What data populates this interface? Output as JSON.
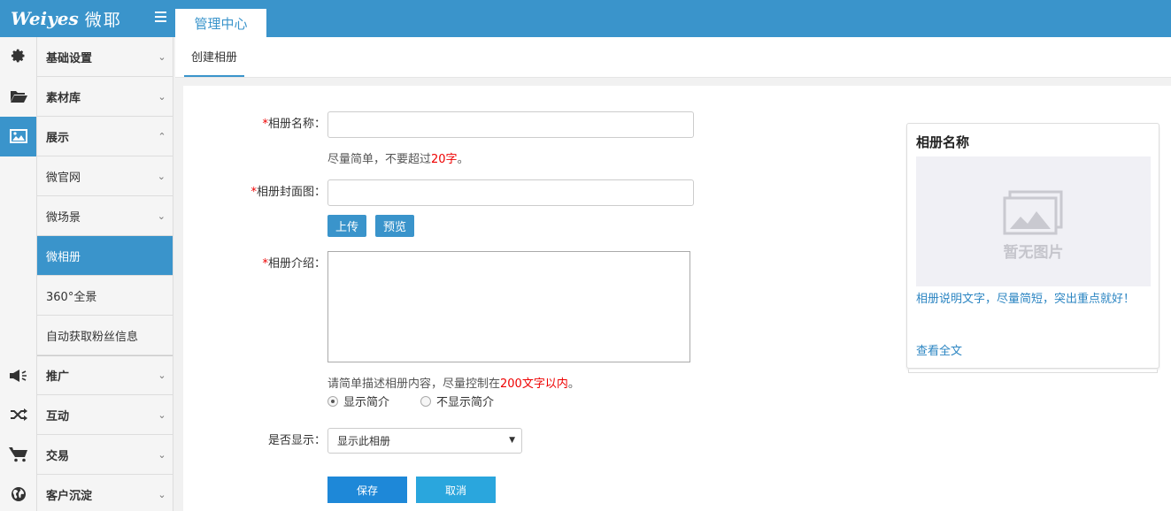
{
  "app": {
    "brand": "Weiyes",
    "brand_cn": "微耶",
    "top_tab": "管理中心"
  },
  "sidebar": {
    "items": [
      {
        "label": "基础设置",
        "icon": "gear-icon",
        "expanded": false
      },
      {
        "label": "素材库",
        "icon": "folder-open-icon",
        "expanded": false
      },
      {
        "label": "展示",
        "icon": "picture-icon",
        "expanded": true,
        "children": [
          {
            "label": "微官网",
            "has_chevron": true
          },
          {
            "label": "微场景",
            "has_chevron": true
          },
          {
            "label": "微相册",
            "active": true
          },
          {
            "label": "360°全景"
          },
          {
            "label": "自动获取粉丝信息"
          }
        ]
      },
      {
        "label": "推广",
        "icon": "megaphone-icon",
        "expanded": false
      },
      {
        "label": "互动",
        "icon": "shuffle-icon",
        "expanded": false
      },
      {
        "label": "交易",
        "icon": "cart-icon",
        "expanded": false
      },
      {
        "label": "客户沉淀",
        "icon": "globe-icon",
        "expanded": false
      }
    ]
  },
  "subtab": "创建相册",
  "form": {
    "name_label": "相册名称：",
    "name_value": "",
    "name_hint": "尽量简单，不要超过",
    "name_hint_red": "20字",
    "name_hint_end": "。",
    "cover_label": "相册封面图：",
    "cover_value": "",
    "upload_button": "上传",
    "preview_button": "预览",
    "intro_label": "相册介绍：",
    "intro_value": "",
    "intro_hint": "请简单描述相册内容，尽量控制在",
    "intro_hint_red": "200文字以内",
    "intro_hint_end": "。",
    "radio_show": "显示简介",
    "radio_hide": "不显示简介",
    "radio_selected": "显示简介",
    "display_label": "是否显示：",
    "display_value": "显示此相册",
    "save_button": "保存",
    "cancel_button": "取消",
    "required_mark": "*"
  },
  "preview": {
    "title": "相册名称",
    "placeholder_text": "暂无图片",
    "description": "相册说明文字，尽量简短，突出重点就好！",
    "more_link": "查看全文"
  },
  "colors": {
    "primary": "#3a94cb",
    "save": "#1e88d8",
    "cancel": "#2aa6dd",
    "required": "#e00000",
    "link": "#2b85c2"
  }
}
